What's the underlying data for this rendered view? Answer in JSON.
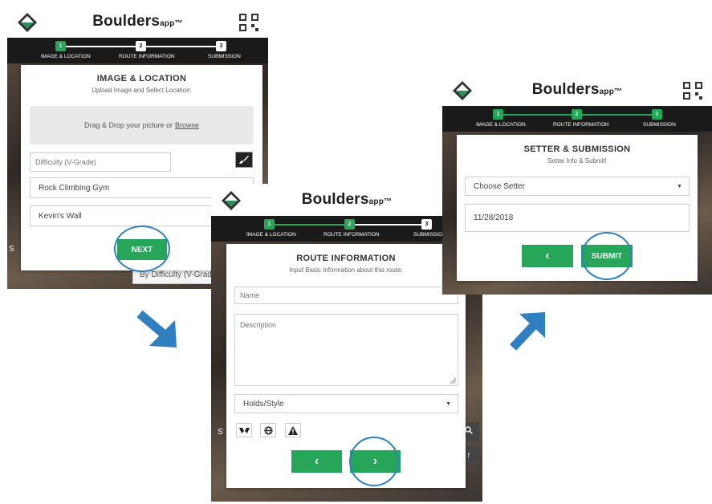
{
  "app": {
    "brand": "Boulders",
    "brand_suffix": "app™"
  },
  "steps": [
    {
      "num": "1",
      "label": "IMAGE & LOCATION"
    },
    {
      "num": "2",
      "label": "ROUTE INFORMATION"
    },
    {
      "num": "3",
      "label": "SUBMISSION"
    }
  ],
  "screen1": {
    "title": "IMAGE & LOCATION",
    "subtitle": "Upload Image and Select Location:",
    "dropzone_text": "Drag & Drop your picture or",
    "dropzone_link": "Browse",
    "difficulty_placeholder": "Difficulty (V-Grade)",
    "gym_value": "Rock Climbing Gym",
    "wall_value": "Kevin's Wall",
    "next_label": "NEXT",
    "behind_text": "By Difficulty (V-Grad",
    "behind_s": "S"
  },
  "screen2": {
    "title": "ROUTE INFORMATION",
    "subtitle": "Input Basic Information about this route:",
    "name_placeholder": "Name",
    "description_placeholder": "Description",
    "holds_value": "Holds/Style",
    "back_label": "‹",
    "next_label": "›",
    "behind_s": "S",
    "behind_r": "r",
    "icons": [
      "hands-icon",
      "globe-icon",
      "warning-icon"
    ]
  },
  "screen3": {
    "title": "SETTER & SUBMISSION",
    "subtitle": "Setter Info & Submit!",
    "setter_value": "Choose Setter",
    "date_value": "11/28/2018",
    "back_label": "‹",
    "submit_label": "SUBMIT"
  },
  "colors": {
    "accent": "#27a65a",
    "highlight": "#2f7fc1",
    "stepbar": "#1a1a1a"
  }
}
